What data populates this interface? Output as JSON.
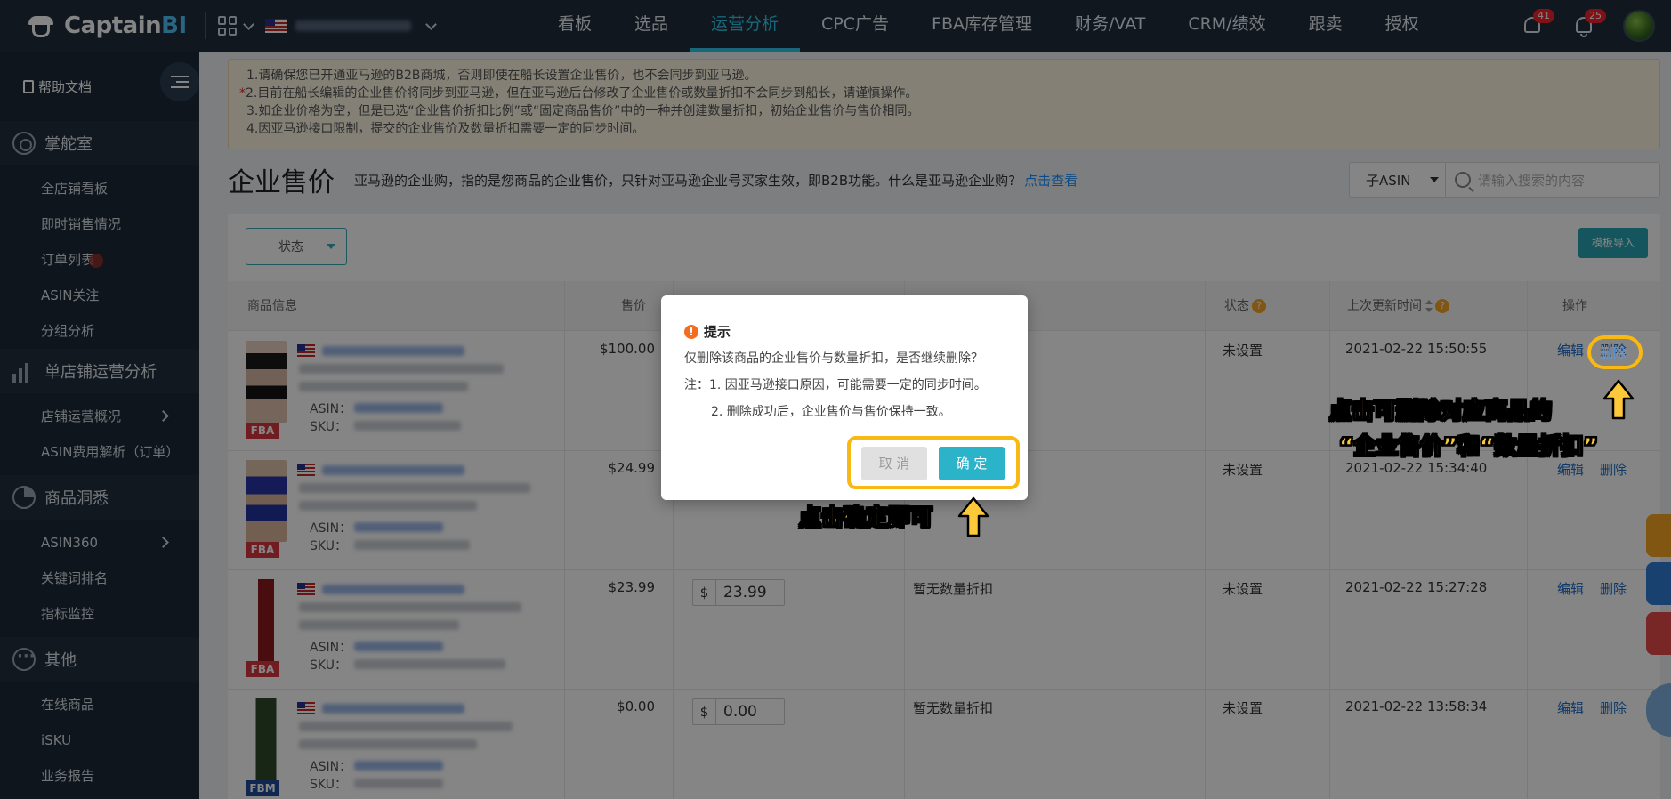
{
  "app": {
    "logo_text_main": "Captain",
    "logo_text_accent": "BI",
    "nav": [
      "看板",
      "选品",
      "运营分析",
      "CPC广告",
      "FBA库存管理",
      "财务/VAT",
      "CRM/绩效",
      "跟卖",
      "授权"
    ],
    "active_nav": "运营分析",
    "alert_count": "41",
    "notify_count": "25"
  },
  "sidebar": {
    "help": "帮助文档",
    "sections": [
      {
        "title": "掌舵室",
        "items": [
          "全店铺看板",
          "即时销售情况",
          "订单列表",
          "ASIN关注",
          "分组分析"
        ]
      },
      {
        "title": "单店铺运营分析",
        "items": [
          "店铺运营概况",
          "ASIN费用解析（订单）"
        ]
      },
      {
        "title": "商品洞悉",
        "items": [
          "ASIN360",
          "关键词排名",
          "指标监控"
        ]
      },
      {
        "title": "其他",
        "items": [
          "在线商品",
          "iSKU",
          "业务报告"
        ]
      }
    ]
  },
  "notice": {
    "line1": "1.请确保您已开通亚马逊的B2B商城，否则即使在船长设置企业售价，也不会同步到亚马逊。",
    "line2_star": "*",
    "line2": "2.目前在船长编辑的企业售价将同步到亚马逊，但在亚马逊后台修改了企业售价或数量折扣不会同步到船长，请谨慎操作。",
    "line3": "3.如企业价格为空，但是已选“企业售价折扣比例”或“固定商品售价”中的一种并创建数量折扣，初始企业售价与售价相同。",
    "line4": "4.因亚马逊接口限制，提交的企业售价及数量折扣需要一定的同步时间。"
  },
  "page": {
    "title": "企业售价",
    "desc": "亚马逊的企业购，指的是您商品的企业售价，只针对亚马逊企业号买家生效，即B2B功能。什么是亚马逊企业购?",
    "link": "点击查看",
    "search_select": "子ASIN",
    "search_placeholder": "请输入搜索的内容",
    "status_filter": "状态",
    "import_button": "模板导入"
  },
  "table": {
    "headers": {
      "product": "商品信息",
      "price": "售价",
      "status": "状态",
      "updated": "上次更新时间",
      "actions": "操作"
    },
    "asin_label": "ASIN：",
    "sku_label": "SKU：",
    "edit": "编辑",
    "delete": "删除",
    "rows": [
      {
        "tag": "FBA",
        "price": "$100.00",
        "biz_cur": "",
        "biz_price": "",
        "discount": "",
        "state": "未设置",
        "time": "2021-02-22 15:50:55"
      },
      {
        "tag": "FBA",
        "price": "$24.99",
        "biz_cur": "",
        "biz_price": "",
        "discount": "",
        "state": "未设置",
        "time": "2021-02-22 15:34:40"
      },
      {
        "tag": "FBA",
        "price": "$23.99",
        "biz_cur": "$",
        "biz_price": "23.99",
        "discount": "暂无数量折扣",
        "state": "未设置",
        "time": "2021-02-22 15:27:28"
      },
      {
        "tag": "FBM",
        "price": "$0.00",
        "biz_cur": "$",
        "biz_price": "0.00",
        "discount": "暂无数量折扣",
        "state": "未设置",
        "time": "2021-02-22 13:58:34"
      }
    ]
  },
  "dialog": {
    "title": "提示",
    "message": "仅删除该商品的企业售价与数量折扣，是否继续删除？",
    "note1": "注：1. 因亚马逊接口原因，可能需要一定的同步时间。",
    "note2": "2. 删除成功后，企业售价与售价保持一致。",
    "cancel": "取 消",
    "ok": "确 定"
  },
  "annotations": {
    "confirm_hint": "点击确定即可",
    "delete_hint_line1": "点击可删除对应商品的",
    "delete_hint_line2": "“企业售价”和“数量折扣”",
    "color": "#f9b915"
  }
}
